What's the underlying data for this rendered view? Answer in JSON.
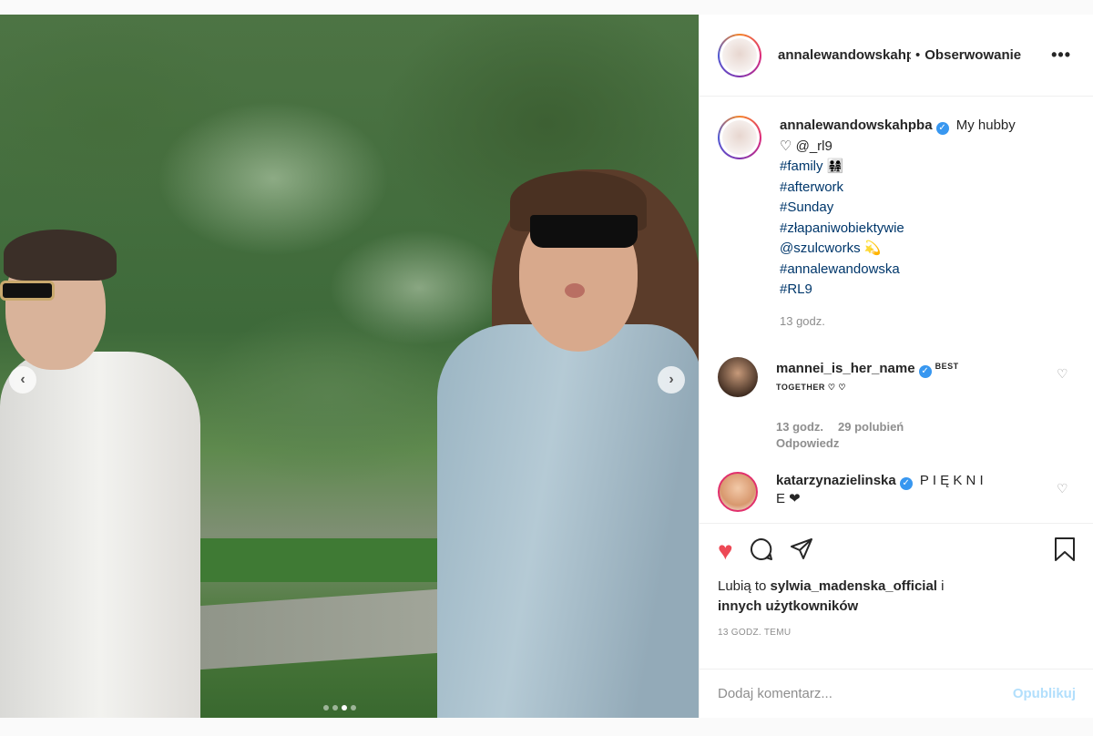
{
  "post": {
    "dots_count": 4,
    "active_dot": 2
  },
  "header": {
    "username": "annalewandowskahpba",
    "separator": "•",
    "follow_label": "Obserwowanie",
    "more_label": "•••"
  },
  "caption": {
    "username": "annalewandowskahpba",
    "verified": "✓",
    "line1": "My hubby",
    "line2": "♡ @_rl9",
    "tags": [
      "#family 👨‍👩‍👧‍👧",
      "#afterwork",
      "#Sunday",
      "#złapaniwobiektywie",
      "@szulcworks 💫",
      "#annalewandowska",
      "#RL9"
    ],
    "time": "13 godz."
  },
  "comments": [
    {
      "username": "mannei_is_her_name",
      "text_small": "BEST",
      "text_line2": "TOGETHER ♡ ♡",
      "time": "13 godz.",
      "likes": "29 polubień",
      "reply": "Odpowiedz"
    },
    {
      "username": "katarzynazielinska",
      "text": "P I Ę K N I",
      "text_line2": "E ❤"
    }
  ],
  "actions": {
    "likes_prefix": "Lubią to ",
    "likes_user": "sylwia_madenska_official",
    "likes_i": " i",
    "likes_rest": "innych użytkowników",
    "posted": "13 GODZ. TEMU"
  },
  "add_comment": {
    "placeholder": "Dodaj komentarz...",
    "publish_label": "Opublikuj"
  },
  "colors": {
    "like_red": "#ed4956",
    "link_blue": "#00376b",
    "verified_blue": "#3897f0",
    "publish_disabled": "#b2dffc"
  }
}
